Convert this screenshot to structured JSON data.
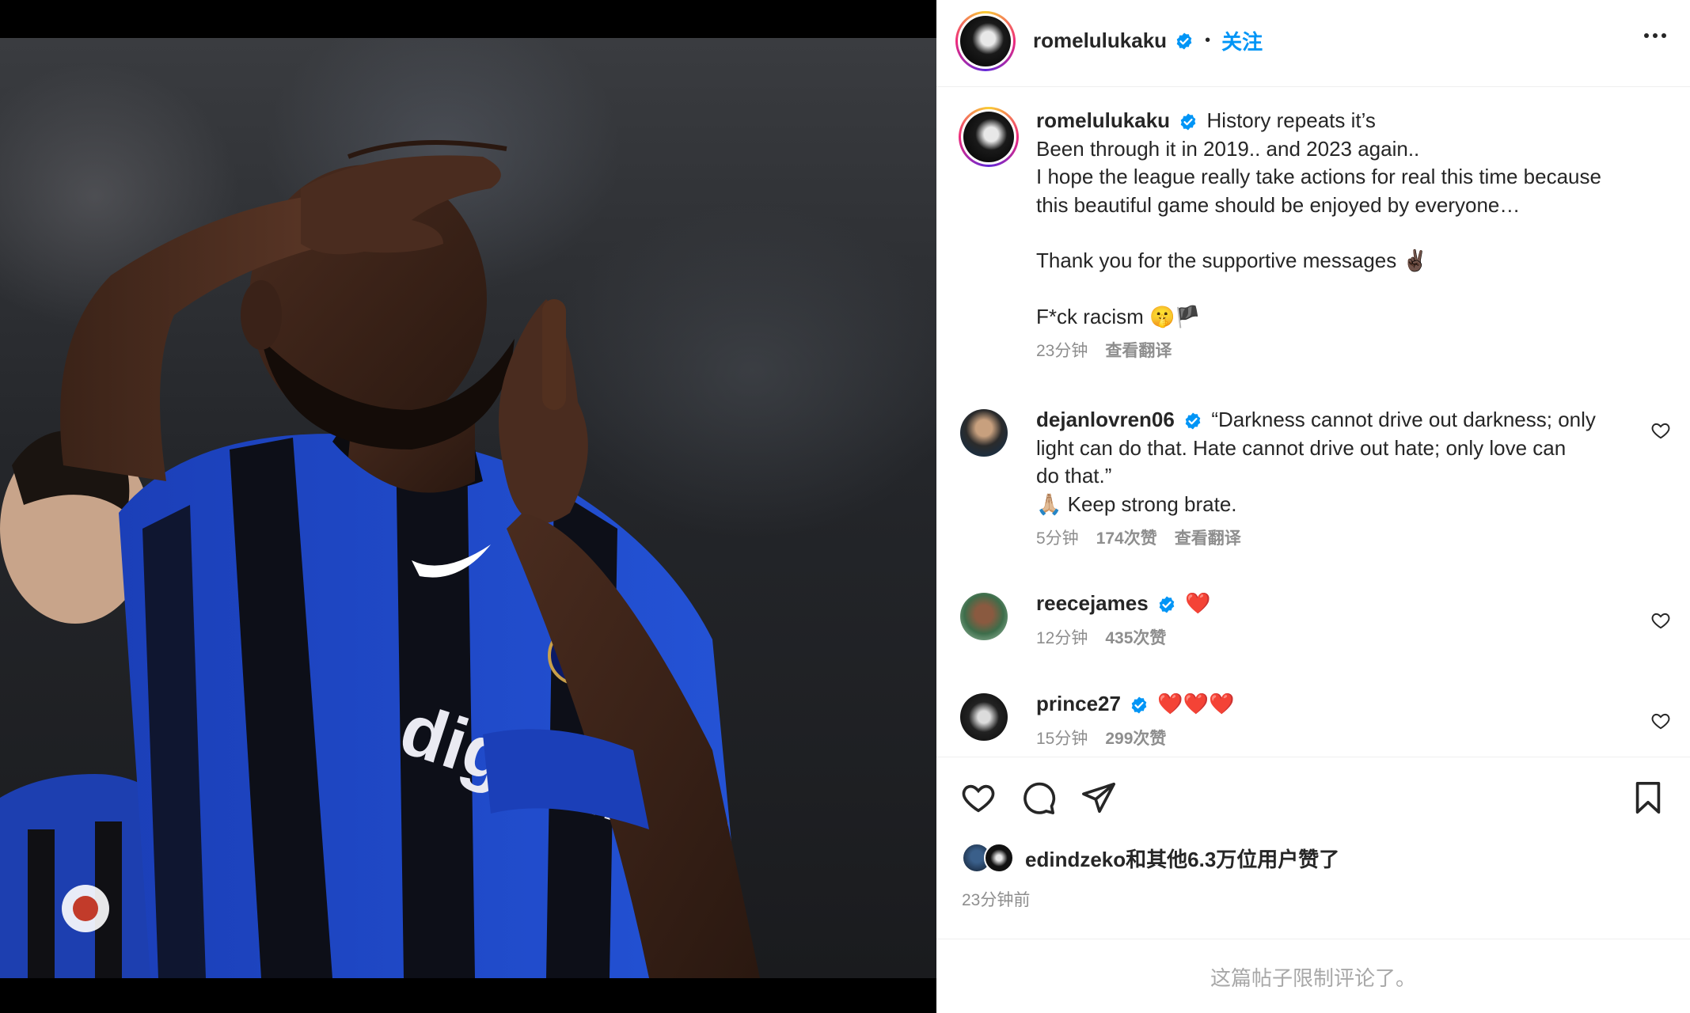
{
  "post": {
    "author": "romelulukaku",
    "follow_label": "关注",
    "caption_lines": [
      "History repeats it’s",
      "Been through it in 2019.. and 2023 again..",
      "I hope the league really take actions for real this time because",
      "this beautiful game should be enjoyed by everyone…",
      "",
      "Thank you for the supportive messages ✌🏿",
      "",
      "F*ck racism 🤫🏴"
    ],
    "caption_time": "23分钟",
    "caption_translate": "查看翻译"
  },
  "comments": [
    {
      "user": "dejanlovren06",
      "lines": [
        "“Darkness cannot drive out darkness; only",
        "light can do that. Hate cannot drive out hate; only love can",
        "do that.”",
        "🙏🏼 Keep strong brate."
      ],
      "time": "5分钟",
      "likes": "174次赞",
      "translate": "查看翻译"
    },
    {
      "user": "reecejames",
      "text": "❤️",
      "time": "12分钟",
      "likes": "435次赞"
    },
    {
      "user": "prince27",
      "text": "❤️❤️❤️",
      "time": "15分钟",
      "likes": "299次赞"
    }
  ],
  "footer": {
    "liked_by": "edindzeko和其他6.3万位用户赞了",
    "post_time": "23分钟前",
    "comments_closed": "这篇帖子限制评论了。"
  },
  "image": {
    "jersey_text": "digitalbits"
  },
  "colors": {
    "accent": "#0095f6",
    "text": "#262626",
    "muted": "#8e8e8e",
    "divider": "#efefef",
    "verified": "#0095f6"
  },
  "icons": [
    "more-icon",
    "verified-icon",
    "heart-icon",
    "comment-icon",
    "share-icon",
    "bookmark-icon"
  ]
}
